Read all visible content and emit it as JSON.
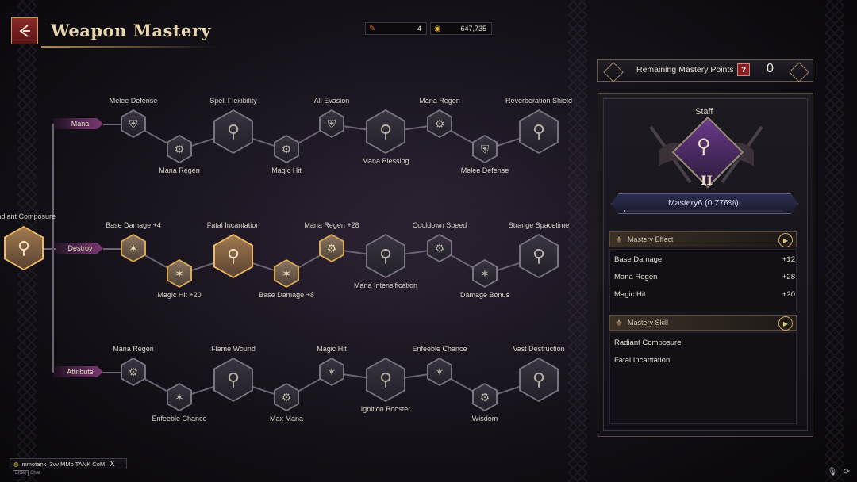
{
  "header": {
    "title": "Weapon Mastery",
    "back_icon": "back-arrow-icon",
    "resources": [
      {
        "icon": "scroll-icon",
        "value": "4"
      },
      {
        "icon": "gold-coin-icon",
        "value": "647,735"
      }
    ]
  },
  "tree": {
    "root": {
      "label": "Radiant Composure"
    },
    "rows": [
      {
        "name": "Mana",
        "nodes": [
          {
            "label": "Melee Defense",
            "icon": "shield-icon",
            "size": "small",
            "state": "locked"
          },
          {
            "label": "Mana Regen",
            "icon": "gear-icon",
            "size": "small",
            "state": "locked"
          },
          {
            "label": "Spell Flexibility",
            "icon": "staff-icon",
            "size": "large",
            "state": "locked"
          },
          {
            "label": "Magic Hit",
            "icon": "gear-play-icon",
            "size": "small",
            "state": "locked"
          },
          {
            "label": "All Evasion",
            "icon": "shield-icon",
            "size": "small",
            "state": "locked"
          },
          {
            "label": "Mana Blessing",
            "icon": "staff-icon",
            "size": "large",
            "state": "locked"
          },
          {
            "label": "Mana Regen",
            "icon": "gear-icon",
            "size": "small",
            "state": "locked"
          },
          {
            "label": "Melee Defense",
            "icon": "shield-icon",
            "size": "small",
            "state": "locked"
          },
          {
            "label": "Reverberation Shield",
            "icon": "staff-icon",
            "size": "large",
            "state": "locked"
          }
        ]
      },
      {
        "name": "Destroy",
        "nodes": [
          {
            "label": "Base Damage +4",
            "icon": "slash-icon",
            "size": "small",
            "state": "learned"
          },
          {
            "label": "Magic Hit +20",
            "icon": "slash-icon",
            "size": "small",
            "state": "learned"
          },
          {
            "label": "Fatal Incantation",
            "icon": "staff-icon",
            "size": "large",
            "state": "active"
          },
          {
            "label": "Base Damage +8",
            "icon": "slash-icon",
            "size": "small",
            "state": "learned"
          },
          {
            "label": "Mana Regen +28",
            "icon": "gear-icon",
            "size": "small",
            "state": "learned"
          },
          {
            "label": "Mana Intensification",
            "icon": "staff-icon",
            "size": "large",
            "state": "locked"
          },
          {
            "label": "Cooldown Speed",
            "icon": "gear-icon",
            "size": "small",
            "state": "locked"
          },
          {
            "label": "Damage Bonus",
            "icon": "slash-icon",
            "size": "small",
            "state": "locked"
          },
          {
            "label": "Strange Spacetime",
            "icon": "staff-icon",
            "size": "large",
            "state": "locked"
          }
        ]
      },
      {
        "name": "Attribute",
        "nodes": [
          {
            "label": "Mana Regen",
            "icon": "gear-icon",
            "size": "small",
            "state": "locked"
          },
          {
            "label": "Enfeeble Chance",
            "icon": "slash-icon",
            "size": "small",
            "state": "locked"
          },
          {
            "label": "Flame Wound",
            "icon": "staff-icon",
            "size": "large",
            "state": "locked"
          },
          {
            "label": "Max Mana",
            "icon": "gear-icon",
            "size": "small",
            "state": "locked"
          },
          {
            "label": "Magic Hit",
            "icon": "slash-icon",
            "size": "small",
            "state": "locked"
          },
          {
            "label": "Ignition Booster",
            "icon": "staff-icon",
            "size": "large",
            "state": "locked"
          },
          {
            "label": "Enfeeble Chance",
            "icon": "slash-icon",
            "size": "small",
            "state": "locked"
          },
          {
            "label": "Wisdom",
            "icon": "gear-icon",
            "size": "small",
            "state": "locked"
          },
          {
            "label": "Vast Destruction",
            "icon": "staff-icon",
            "size": "large",
            "state": "locked"
          }
        ]
      }
    ]
  },
  "panel": {
    "remaining_label": "Remaining Mastery Points",
    "help": "?",
    "remaining_value": "0",
    "weapon": "Staff",
    "rank": "II",
    "mastery_text": "Mastery6  (0.776%)",
    "mastery_progress_percent": 0.776,
    "effect_title": "Mastery Effect",
    "effects": [
      {
        "name": "Base Damage",
        "value": "+12"
      },
      {
        "name": "Mana Regen",
        "value": "+28"
      },
      {
        "name": "Magic Hit",
        "value": "+20"
      }
    ],
    "skill_title": "Mastery Skill",
    "skills": [
      "Radiant Composure",
      "Fatal Incantation"
    ]
  },
  "chat": {
    "user": "mmotank",
    "message": "3vv MMo TANK CoM",
    "close": "X",
    "key_hint": "Enter",
    "key_label": "Chat"
  }
}
